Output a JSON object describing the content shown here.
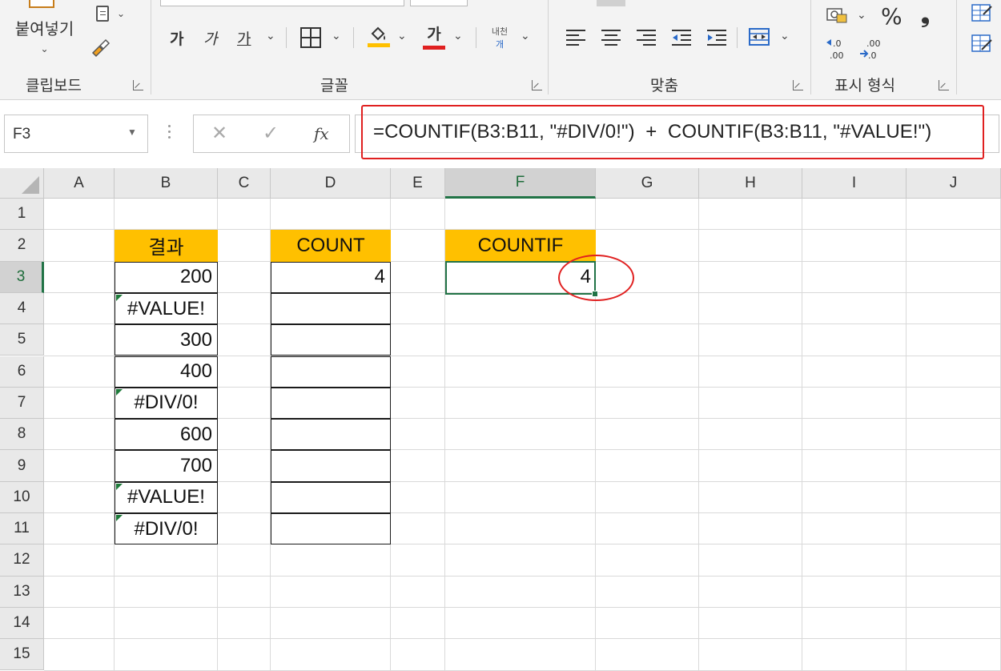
{
  "ribbon": {
    "clipboard": {
      "paste_label": "붙여넣기",
      "group_label": "클립보드"
    },
    "font": {
      "bold": "가",
      "italic": "가",
      "underline": "가",
      "font_color_glyph": "가",
      "wrap_label": "내천",
      "wrap_sub": "개",
      "group_label": "글꼴",
      "fill_color": "#ffc000",
      "font_color": "#e02020"
    },
    "alignment": {
      "group_label": "맞춤"
    },
    "number": {
      "percent": "%",
      "comma": "❟",
      "increase_decimal": ".0\n.00",
      "decrease_decimal": ".00\n→.0",
      "group_label": "표시 형식"
    }
  },
  "formula_bar": {
    "name_box": "F3",
    "cancel": "✕",
    "enter": "✓",
    "fx": "fx",
    "formula": "=COUNTIF(B3:B11, \"#DIV/0!\")  +  COUNTIF(B3:B11, \"#VALUE!\")"
  },
  "sheet": {
    "columns": [
      "A",
      "B",
      "C",
      "D",
      "E",
      "F",
      "G",
      "H",
      "I",
      "J"
    ],
    "rows": [
      "1",
      "2",
      "3",
      "4",
      "5",
      "6",
      "7",
      "8",
      "9",
      "10",
      "11",
      "12",
      "13",
      "14",
      "15"
    ],
    "selected_column": "F",
    "selected_row": "3",
    "header_color": "#ffc000",
    "accent": "#217346",
    "b_header": "결과",
    "b_values": [
      "200",
      "#VALUE!",
      "300",
      "400",
      "#DIV/0!",
      "600",
      "700",
      "#VALUE!",
      "#DIV/0!"
    ],
    "d_header": "COUNT",
    "d3": "4",
    "f_header": "COUNTIF",
    "f3": "4"
  }
}
